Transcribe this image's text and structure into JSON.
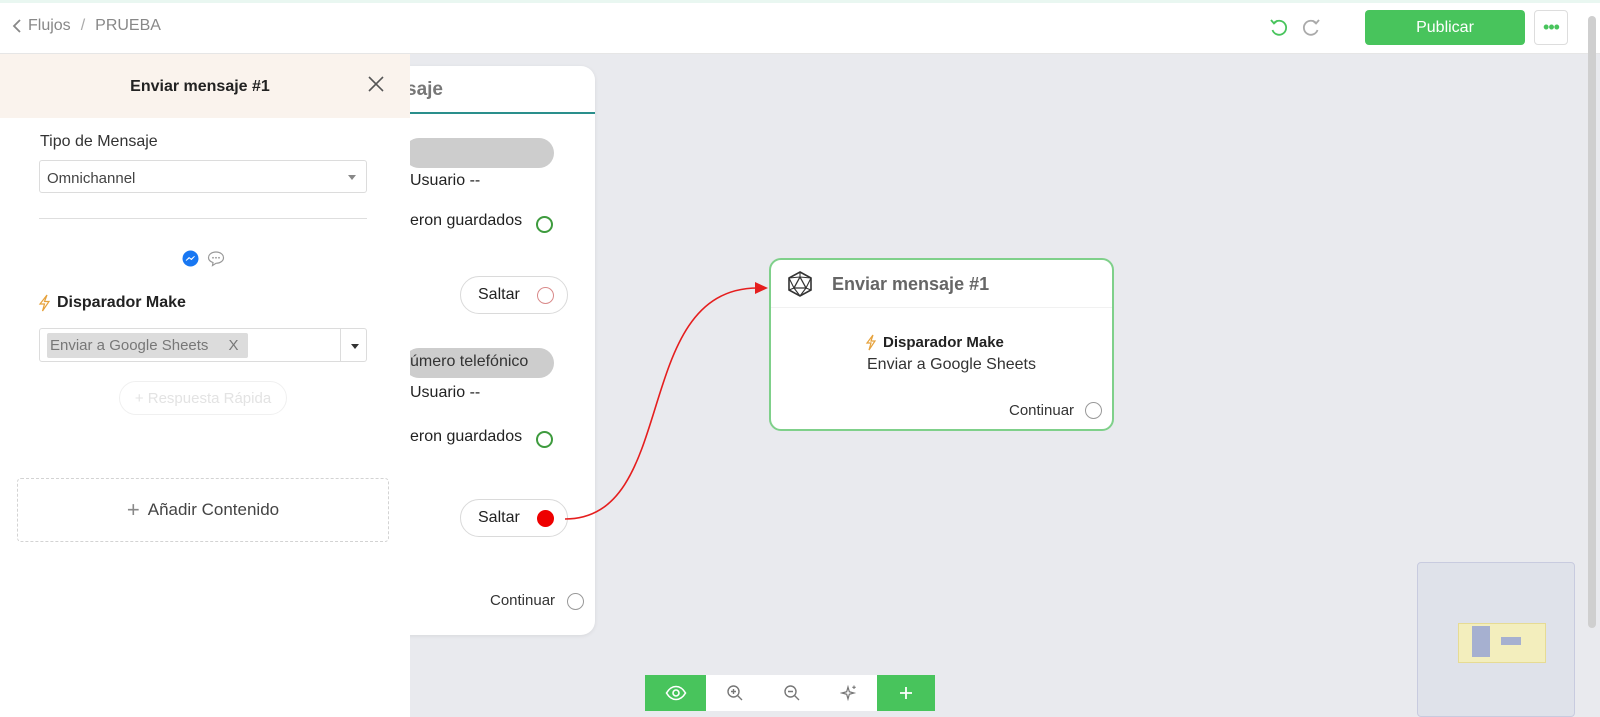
{
  "header": {
    "back_label": "Flujos",
    "separator": "/",
    "flow_name": "PRUEBA",
    "publish_label": "Publicar",
    "more_label": "•••"
  },
  "panel": {
    "title": "Enviar mensaje #1",
    "message_type_label": "Tipo de Mensaje",
    "message_type_value": "Omnichannel",
    "channel_icons": [
      "messenger-icon",
      "chat-bubble-icon"
    ],
    "trigger_title": "Disparador Make",
    "trigger_tag": "Enviar a Google Sheets",
    "trigger_tag_remove": "X",
    "quick_reply_label": "+ Respuesta Rápida",
    "add_content_plus": "+",
    "add_content_label": "Añadir Contenido"
  },
  "node_a": {
    "title_partial": "saje",
    "pill1": "",
    "row1": "Usuario --",
    "row2": "eron guardados",
    "jump1": "Saltar",
    "pill2": "úmero telefónico",
    "row3": "Usuario --",
    "row4": "eron guardados",
    "jump2": "Saltar",
    "continue": "Continuar"
  },
  "node_b": {
    "title": "Enviar mensaje #1",
    "trigger_title": "Disparador Make",
    "trigger_value": "Enviar a Google Sheets",
    "continue": "Continuar"
  },
  "colors": {
    "accent_green": "#48c45c",
    "edge_red": "#e51e1e",
    "node_border": "#7fd08a",
    "panel_header_bg": "#faf3ed"
  }
}
